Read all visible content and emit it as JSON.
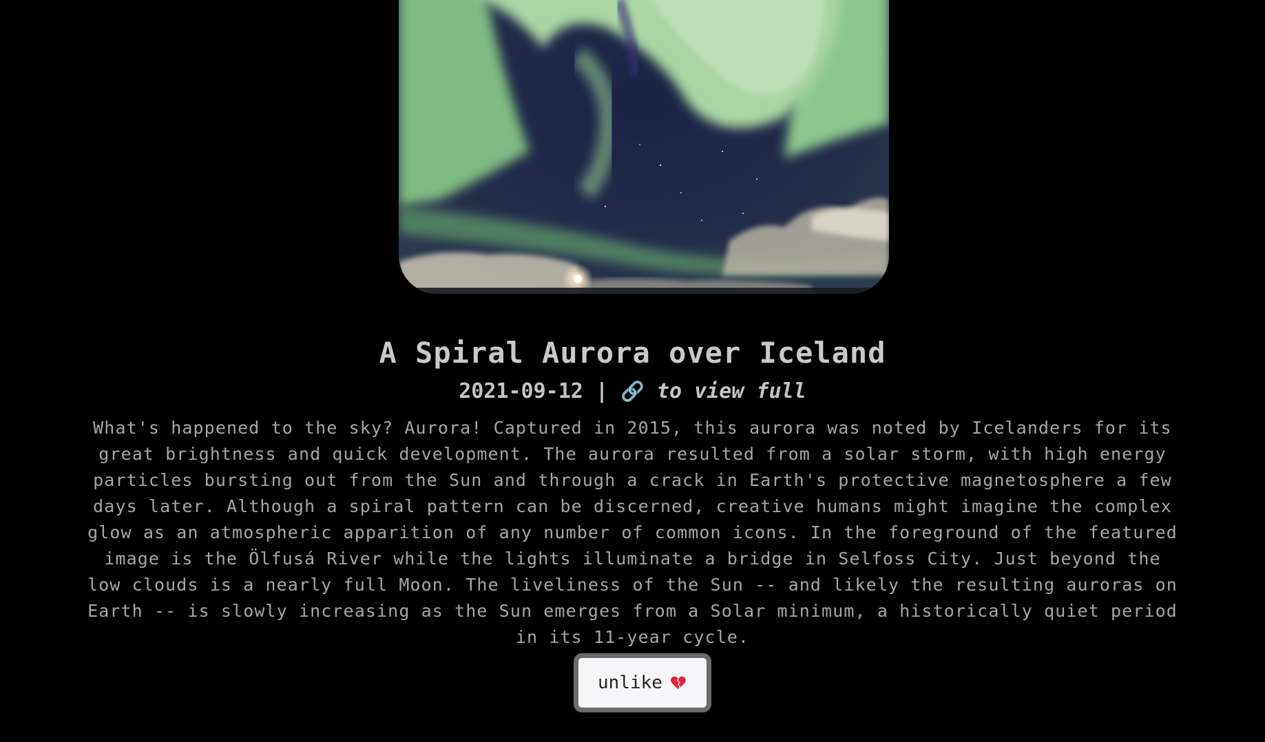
{
  "apod": {
    "title": "A Spiral Aurora over Iceland",
    "date": "2021-09-12",
    "separator": "|",
    "link_icon": "link-icon",
    "link_text": "to view full",
    "explanation": "What's happened to the sky? Aurora! Captured in 2015, this aurora was noted by Icelanders for its great brightness and quick development. The aurora resulted from a solar storm, with high energy particles bursting out from the Sun and through a crack in Earth's protective magnetosphere a few days later. Although a spiral pattern can be discerned, creative humans might imagine the complex glow as an atmospheric apparition of any number of common icons. In the foreground of the featured image is the Ölfusá River while the lights illuminate a bridge in Selfoss City. Just beyond the low clouds is a nearly full Moon. The liveliness of the Sun -- and likely the resulting auroras on Earth -- is slowly increasing as the Sun emerges from a Solar minimum, a historically quiet period in its 11-year cycle."
  },
  "like_button": {
    "label": "unlike",
    "icon": "broken-heart-icon"
  },
  "colors": {
    "background": "#000000",
    "title_text": "#c9c9c9",
    "body_text": "#a6a6a6",
    "button_border": "#6b6b6b",
    "button_bg": "#f7f7f9",
    "heart": "#e0243a",
    "aurora_green": "#9fd49a",
    "sky_navy": "#1c2540"
  }
}
